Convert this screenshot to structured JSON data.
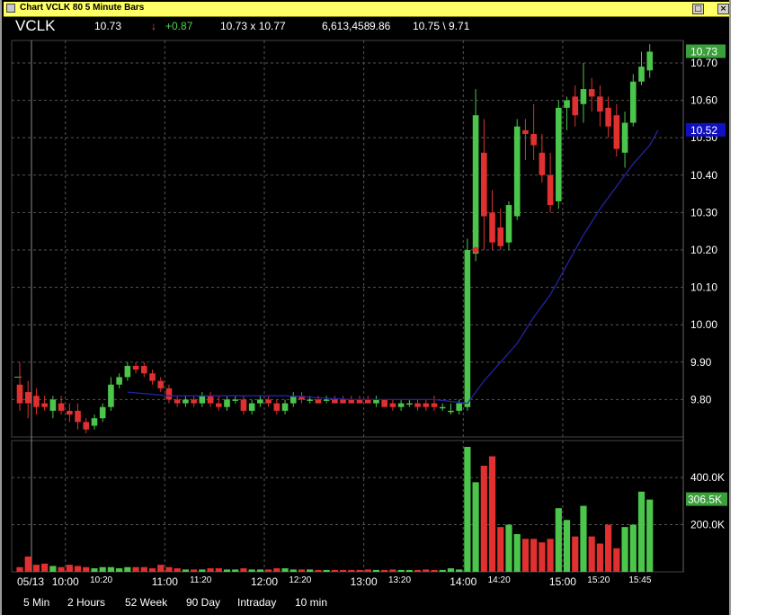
{
  "window": {
    "title": "Chart VCLK 80 5 Minute Bars",
    "restore_glyph": "□",
    "close_glyph": "×"
  },
  "quote": {
    "symbol": "VCLK",
    "last": "10.73",
    "change_arrow": "↓",
    "change": "+0.87",
    "bid_ask": "10.73  x  10.77",
    "volume": "6,613,458",
    "prev_close": "9.86",
    "high_low": "10.75 \\ 9.71"
  },
  "colors": {
    "background": "#000000",
    "up": "#4cc54c",
    "down": "#e03030",
    "moving_average": "#2323a8",
    "grid": "#555555",
    "last_price_tag": "#3aa03a",
    "ma_tag": "#1010c0"
  },
  "timeframes": [
    "5 Min",
    "2 Hours",
    "52 Week",
    "90 Day",
    "Intraday",
    "10 min"
  ],
  "chart_data": {
    "type": "candlestick",
    "interval": "5 Minute Bars",
    "date_label": "05/13",
    "price_axis": {
      "min": 9.7,
      "max": 10.76,
      "ticks": [
        "10.70",
        "10.60",
        "10.50",
        "10.40",
        "10.30",
        "10.20",
        "10.10",
        "10.00",
        "9.90",
        "9.80"
      ],
      "grid": true
    },
    "volume_axis": {
      "max": 530000,
      "ticks": [
        "400.0K",
        "200.0K"
      ],
      "grid": true
    },
    "x_labels": [
      {
        "text": "05/13",
        "major": true,
        "bar": 0
      },
      {
        "text": "10:00",
        "major": true,
        "bar": 6
      },
      {
        "text": "10:20",
        "major": false,
        "bar": 10
      },
      {
        "text": "11:00",
        "major": true,
        "bar": 18
      },
      {
        "text": "11:20",
        "major": false,
        "bar": 22
      },
      {
        "text": "12:00",
        "major": true,
        "bar": 30
      },
      {
        "text": "12:20",
        "major": false,
        "bar": 34
      },
      {
        "text": "13:00",
        "major": true,
        "bar": 42
      },
      {
        "text": "13:20",
        "major": false,
        "bar": 46
      },
      {
        "text": "14:00",
        "major": true,
        "bar": 54
      },
      {
        "text": "14:20",
        "major": false,
        "bar": 58
      },
      {
        "text": "15:00",
        "major": true,
        "bar": 66
      },
      {
        "text": "15:20",
        "major": false,
        "bar": 70
      },
      {
        "text": "15:45",
        "major": false,
        "bar": 75
      }
    ],
    "last_price_tag": "10.73",
    "ma_price_tag": "10.52",
    "volume_tag": "306.5K",
    "pre_market_tick": 9.86,
    "candles": [
      {
        "o": 9.84,
        "h": 9.9,
        "l": 9.77,
        "c": 9.79,
        "v": 20000
      },
      {
        "o": 9.82,
        "h": 9.85,
        "l": 9.75,
        "c": 9.79,
        "v": 65000
      },
      {
        "o": 9.81,
        "h": 9.83,
        "l": 9.76,
        "c": 9.78,
        "v": 30000
      },
      {
        "o": 9.79,
        "h": 9.81,
        "l": 9.77,
        "c": 9.78,
        "v": 35000
      },
      {
        "o": 9.77,
        "h": 9.81,
        "l": 9.75,
        "c": 9.8,
        "v": 25000
      },
      {
        "o": 9.79,
        "h": 9.81,
        "l": 9.76,
        "c": 9.77,
        "v": 20000
      },
      {
        "o": 9.77,
        "h": 9.79,
        "l": 9.74,
        "c": 9.76,
        "v": 30000
      },
      {
        "o": 9.77,
        "h": 9.79,
        "l": 9.72,
        "c": 9.74,
        "v": 25000
      },
      {
        "o": 9.74,
        "h": 9.75,
        "l": 9.71,
        "c": 9.72,
        "v": 20000
      },
      {
        "o": 9.73,
        "h": 9.76,
        "l": 9.72,
        "c": 9.75,
        "v": 15000
      },
      {
        "o": 9.75,
        "h": 9.79,
        "l": 9.74,
        "c": 9.78,
        "v": 20000
      },
      {
        "o": 9.78,
        "h": 9.86,
        "l": 9.77,
        "c": 9.84,
        "v": 20000
      },
      {
        "o": 9.84,
        "h": 9.87,
        "l": 9.83,
        "c": 9.86,
        "v": 15000
      },
      {
        "o": 9.86,
        "h": 9.9,
        "l": 9.85,
        "c": 9.89,
        "v": 20000
      },
      {
        "o": 9.89,
        "h": 9.9,
        "l": 9.87,
        "c": 9.88,
        "v": 20000
      },
      {
        "o": 9.89,
        "h": 9.9,
        "l": 9.86,
        "c": 9.87,
        "v": 20000
      },
      {
        "o": 9.87,
        "h": 9.88,
        "l": 9.84,
        "c": 9.85,
        "v": 15000
      },
      {
        "o": 9.85,
        "h": 9.86,
        "l": 9.82,
        "c": 9.83,
        "v": 30000
      },
      {
        "o": 9.83,
        "h": 9.84,
        "l": 9.79,
        "c": 9.8,
        "v": 20000
      },
      {
        "o": 9.8,
        "h": 9.81,
        "l": 9.78,
        "c": 9.79,
        "v": 15000
      },
      {
        "o": 9.79,
        "h": 9.81,
        "l": 9.78,
        "c": 9.8,
        "v": 10000
      },
      {
        "o": 9.8,
        "h": 9.81,
        "l": 9.78,
        "c": 9.79,
        "v": 10000
      },
      {
        "o": 9.79,
        "h": 9.82,
        "l": 9.78,
        "c": 9.81,
        "v": 10000
      },
      {
        "o": 9.81,
        "h": 9.82,
        "l": 9.78,
        "c": 9.79,
        "v": 15000
      },
      {
        "o": 9.79,
        "h": 9.81,
        "l": 9.77,
        "c": 9.78,
        "v": 15000
      },
      {
        "o": 9.78,
        "h": 9.81,
        "l": 9.77,
        "c": 9.8,
        "v": 10000
      },
      {
        "o": 9.8,
        "h": 9.81,
        "l": 9.79,
        "c": 9.8,
        "v": 10000
      },
      {
        "o": 9.8,
        "h": 9.81,
        "l": 9.76,
        "c": 9.77,
        "v": 15000
      },
      {
        "o": 9.77,
        "h": 9.8,
        "l": 9.76,
        "c": 9.79,
        "v": 10000
      },
      {
        "o": 9.79,
        "h": 9.81,
        "l": 9.78,
        "c": 9.8,
        "v": 10000
      },
      {
        "o": 9.8,
        "h": 9.81,
        "l": 9.78,
        "c": 9.79,
        "v": 10000
      },
      {
        "o": 9.79,
        "h": 9.8,
        "l": 9.76,
        "c": 9.77,
        "v": 15000
      },
      {
        "o": 9.77,
        "h": 9.8,
        "l": 9.76,
        "c": 9.79,
        "v": 15000
      },
      {
        "o": 9.79,
        "h": 9.82,
        "l": 9.78,
        "c": 9.81,
        "v": 10000
      },
      {
        "o": 9.81,
        "h": 9.82,
        "l": 9.79,
        "c": 9.8,
        "v": 10000
      },
      {
        "o": 9.8,
        "h": 9.81,
        "l": 9.79,
        "c": 9.8,
        "v": 10000
      },
      {
        "o": 9.8,
        "h": 9.81,
        "l": 9.79,
        "c": 9.79,
        "v": 8000
      },
      {
        "o": 9.8,
        "h": 9.81,
        "l": 9.79,
        "c": 9.8,
        "v": 8000
      },
      {
        "o": 9.8,
        "h": 9.81,
        "l": 9.79,
        "c": 9.79,
        "v": 8000
      },
      {
        "o": 9.8,
        "h": 9.81,
        "l": 9.79,
        "c": 9.79,
        "v": 8000
      },
      {
        "o": 9.8,
        "h": 9.81,
        "l": 9.79,
        "c": 9.79,
        "v": 8000
      },
      {
        "o": 9.8,
        "h": 9.81,
        "l": 9.79,
        "c": 9.79,
        "v": 8000
      },
      {
        "o": 9.8,
        "h": 9.81,
        "l": 9.79,
        "c": 9.79,
        "v": 10000
      },
      {
        "o": 9.79,
        "h": 9.81,
        "l": 9.78,
        "c": 9.8,
        "v": 8000
      },
      {
        "o": 9.8,
        "h": 9.8,
        "l": 9.78,
        "c": 9.78,
        "v": 8000
      },
      {
        "o": 9.79,
        "h": 9.8,
        "l": 9.77,
        "c": 9.78,
        "v": 10000
      },
      {
        "o": 9.78,
        "h": 9.8,
        "l": 9.77,
        "c": 9.79,
        "v": 8000
      },
      {
        "o": 9.79,
        "h": 9.8,
        "l": 9.78,
        "c": 9.79,
        "v": 8000
      },
      {
        "o": 9.79,
        "h": 9.8,
        "l": 9.77,
        "c": 9.78,
        "v": 8000
      },
      {
        "o": 9.79,
        "h": 9.8,
        "l": 9.77,
        "c": 9.78,
        "v": 10000
      },
      {
        "o": 9.79,
        "h": 9.81,
        "l": 9.77,
        "c": 9.78,
        "v": 8000
      },
      {
        "o": 9.78,
        "h": 9.79,
        "l": 9.77,
        "c": 9.78,
        "v": 8000
      },
      {
        "o": 9.77,
        "h": 9.79,
        "l": 9.76,
        "c": 9.77,
        "v": 15000
      },
      {
        "o": 9.77,
        "h": 9.8,
        "l": 9.76,
        "c": 9.79,
        "v": 10000
      },
      {
        "o": 9.78,
        "h": 10.23,
        "l": 9.77,
        "c": 10.2,
        "v": 530000
      },
      {
        "o": 10.19,
        "h": 10.63,
        "l": 10.17,
        "c": 10.56,
        "v": 380000
      },
      {
        "o": 10.46,
        "h": 10.55,
        "l": 10.2,
        "c": 10.29,
        "v": 450000
      },
      {
        "o": 10.3,
        "h": 10.36,
        "l": 10.2,
        "c": 10.22,
        "v": 490000
      },
      {
        "o": 10.26,
        "h": 10.31,
        "l": 10.2,
        "c": 10.21,
        "v": 190000
      },
      {
        "o": 10.22,
        "h": 10.33,
        "l": 10.2,
        "c": 10.32,
        "v": 200000
      },
      {
        "o": 10.29,
        "h": 10.55,
        "l": 10.28,
        "c": 10.53,
        "v": 160000
      },
      {
        "o": 10.52,
        "h": 10.55,
        "l": 10.44,
        "c": 10.51,
        "v": 140000
      },
      {
        "o": 10.51,
        "h": 10.59,
        "l": 10.44,
        "c": 10.48,
        "v": 140000
      },
      {
        "o": 10.46,
        "h": 10.51,
        "l": 10.38,
        "c": 10.4,
        "v": 125000
      },
      {
        "o": 10.4,
        "h": 10.46,
        "l": 10.3,
        "c": 10.32,
        "v": 140000
      },
      {
        "o": 10.33,
        "h": 10.6,
        "l": 10.31,
        "c": 10.58,
        "v": 270000
      },
      {
        "o": 10.58,
        "h": 10.61,
        "l": 10.52,
        "c": 10.6,
        "v": 220000
      },
      {
        "o": 10.61,
        "h": 10.64,
        "l": 10.53,
        "c": 10.56,
        "v": 150000
      },
      {
        "o": 10.59,
        "h": 10.7,
        "l": 10.54,
        "c": 10.63,
        "v": 280000
      },
      {
        "o": 10.63,
        "h": 10.66,
        "l": 10.57,
        "c": 10.61,
        "v": 150000
      },
      {
        "o": 10.61,
        "h": 10.64,
        "l": 10.53,
        "c": 10.57,
        "v": 120000
      },
      {
        "o": 10.58,
        "h": 10.61,
        "l": 10.5,
        "c": 10.53,
        "v": 200000
      },
      {
        "o": 10.56,
        "h": 10.59,
        "l": 10.45,
        "c": 10.47,
        "v": 100000
      },
      {
        "o": 10.46,
        "h": 10.57,
        "l": 10.42,
        "c": 10.54,
        "v": 190000
      },
      {
        "o": 10.54,
        "h": 10.67,
        "l": 10.53,
        "c": 10.65,
        "v": 200000
      },
      {
        "o": 10.65,
        "h": 10.73,
        "l": 10.64,
        "c": 10.69,
        "v": 340000
      },
      {
        "o": 10.68,
        "h": 10.75,
        "l": 10.66,
        "c": 10.73,
        "v": 306500
      }
    ],
    "moving_average": [
      [
        13,
        9.82
      ],
      [
        18,
        9.81
      ],
      [
        28,
        9.81
      ],
      [
        32,
        9.81
      ],
      [
        40,
        9.8
      ],
      [
        50,
        9.8
      ],
      [
        54,
        9.79
      ],
      [
        56,
        9.85
      ],
      [
        58,
        9.9
      ],
      [
        60,
        9.95
      ],
      [
        62,
        10.02
      ],
      [
        64,
        10.08
      ],
      [
        66,
        10.16
      ],
      [
        68,
        10.24
      ],
      [
        70,
        10.31
      ],
      [
        72,
        10.37
      ],
      [
        74,
        10.43
      ],
      [
        76,
        10.48
      ],
      [
        77,
        10.52
      ]
    ],
    "markers": [
      {
        "bar": 55,
        "price": 10.25,
        "color": "#4cc54c"
      },
      {
        "bar": 55,
        "price": 10.2,
        "color": "#e03030"
      }
    ]
  }
}
